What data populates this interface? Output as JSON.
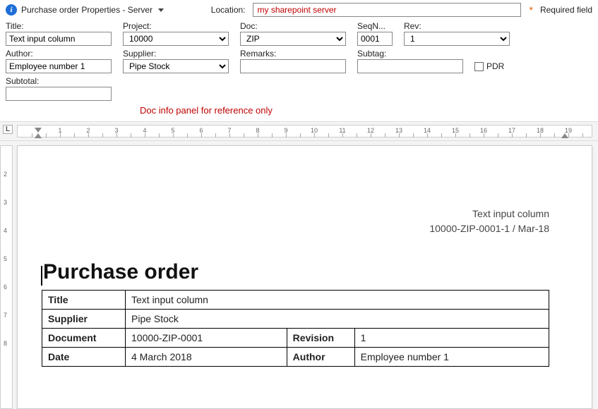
{
  "header": {
    "title": "Purchase order Properties - Server",
    "location_label": "Location:",
    "location_value": "my sharepoint server",
    "required_text": "Required field"
  },
  "fields": {
    "title": {
      "label": "Title:",
      "value": "Text input column"
    },
    "project": {
      "label": "Project:",
      "value": "10000"
    },
    "doc": {
      "label": "Doc:",
      "value": "ZIP"
    },
    "seq": {
      "label": "SeqN...",
      "value": "0001"
    },
    "rev": {
      "label": "Rev:",
      "value": "1"
    },
    "author": {
      "label": "Author:",
      "value": "Employee number 1"
    },
    "supplier": {
      "label": "Supplier:",
      "value": "Pipe Stock"
    },
    "remarks": {
      "label": "Remarks:",
      "value": ""
    },
    "subtag": {
      "label": "Subtag:",
      "value": ""
    },
    "pdr": {
      "label": "PDR"
    },
    "subtotal": {
      "label": "Subtotal:",
      "value": ""
    }
  },
  "note": "Doc info panel for reference only",
  "document": {
    "meta_line1": "Text input column",
    "meta_line2": "10000-ZIP-0001-1 / Mar-18",
    "heading": "Purchase order",
    "rows": {
      "title_lbl": "Title",
      "title_val": "Text input column",
      "supplier_lbl": "Supplier",
      "supplier_val": "Pipe Stock",
      "document_lbl": "Document",
      "document_val": "10000-ZIP-0001",
      "revision_lbl": "Revision",
      "revision_val": "1",
      "date_lbl": "Date",
      "date_val": "4 March 2018",
      "author_lbl": "Author",
      "author_val": "Employee number 1"
    }
  }
}
